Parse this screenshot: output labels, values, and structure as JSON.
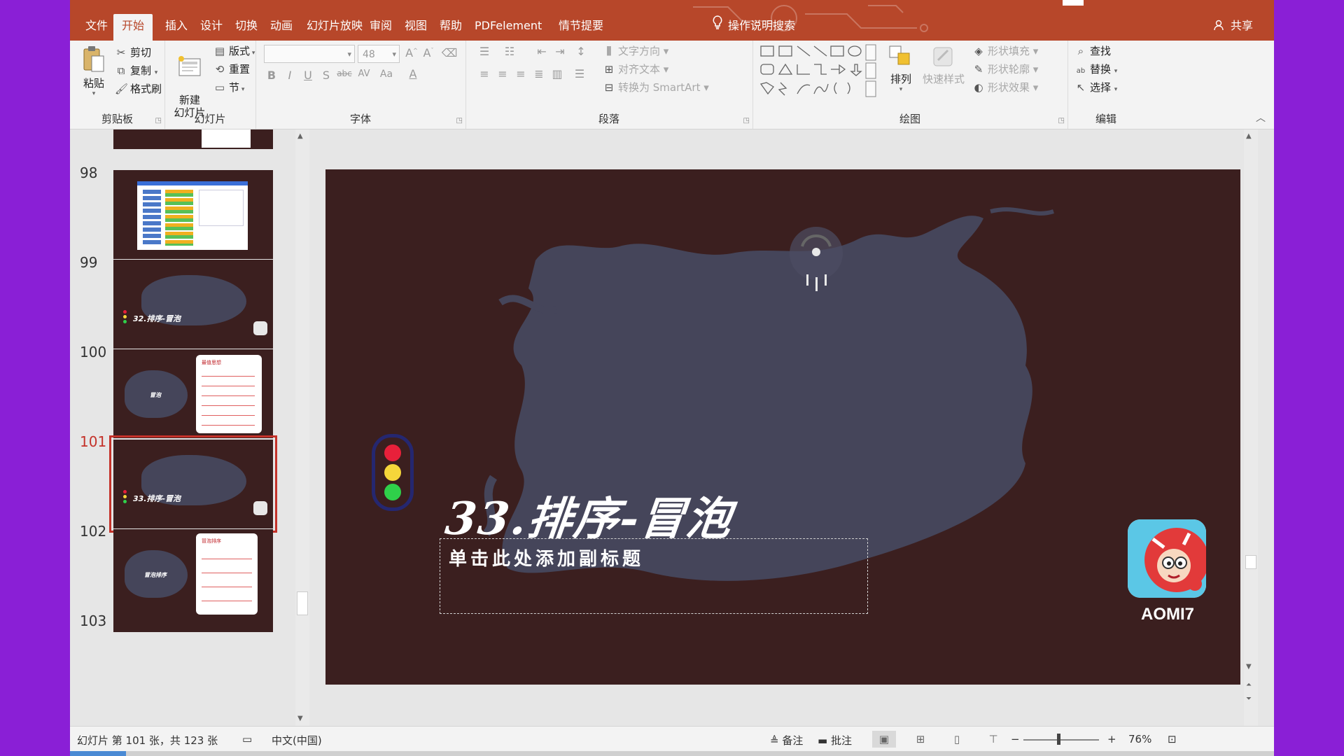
{
  "ribbon_tabs": [
    {
      "label": "文件"
    },
    {
      "label": "开始",
      "active": true
    },
    {
      "label": "插入"
    },
    {
      "label": "设计"
    },
    {
      "label": "切换"
    },
    {
      "label": "动画"
    },
    {
      "label": "幻灯片放映"
    },
    {
      "label": "审阅"
    },
    {
      "label": "视图"
    },
    {
      "label": "帮助"
    },
    {
      "label": "PDFelement"
    },
    {
      "label": "情节提要"
    }
  ],
  "search_tip": "操作说明搜索",
  "share_label": "共享",
  "clipboard": {
    "paste": "粘贴",
    "cut": "剪切",
    "copy": "复制",
    "format_painter": "格式刷",
    "group_label": "剪贴板"
  },
  "slides_group": {
    "new_slide": "新建\n幻灯片",
    "layout": "版式",
    "reset": "重置",
    "section": "节",
    "group_label": "幻灯片"
  },
  "font_group": {
    "font_size": "48",
    "group_label": "字体"
  },
  "paragraph_group": {
    "text_direction": "文字方向",
    "align_text": "对齐文本",
    "convert_smartart": "转换为 SmartArt",
    "group_label": "段落"
  },
  "drawing_group": {
    "arrange": "排列",
    "quick_styles": "快速样式",
    "shape_fill": "形状填充",
    "shape_outline": "形状轮廓",
    "shape_effects": "形状效果",
    "group_label": "绘图"
  },
  "editing_group": {
    "find": "查找",
    "replace": "替换",
    "select": "选择",
    "group_label": "编辑"
  },
  "thumbnails": [
    {
      "number": "98"
    },
    {
      "number": "99",
      "title": "32.排序-冒泡"
    },
    {
      "number": "100",
      "title": "冒泡",
      "card_title": "最值思想"
    },
    {
      "number": "101",
      "title": "33.排序-冒泡",
      "selected": true
    },
    {
      "number": "102",
      "title": "冒泡排序",
      "card_title": "冒泡排序"
    },
    {
      "number": "103"
    }
  ],
  "slide": {
    "title": "33.排序-冒泡",
    "subtitle_placeholder": "单击此处添加副标题",
    "logo_text": "AOMI7",
    "background_color": "#3b1f1f",
    "brush_color": "#45455a",
    "traffic_light": [
      "#e8203a",
      "#f5d63a",
      "#2fd04a"
    ]
  },
  "status": {
    "slide_info": "幻灯片 第 101 张，共 123 张",
    "language": "中文(中国)",
    "notes": "备注",
    "comments": "批注",
    "zoom": "76%"
  },
  "colors": {
    "accent": "#b7472a",
    "selection": "#c4322a",
    "outer_bg": "#8a1fd6"
  }
}
